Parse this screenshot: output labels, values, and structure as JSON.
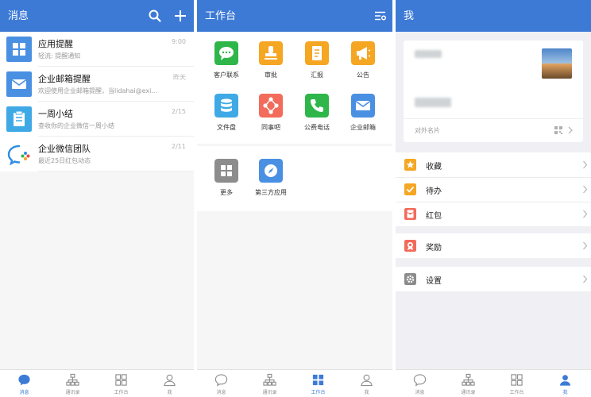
{
  "colors": {
    "primary": "#3d7ad6",
    "tab_inactive": "#8e8e8e"
  },
  "messages": {
    "header": {
      "title": "消息",
      "search_icon": "search-icon",
      "add_icon": "plus-icon"
    },
    "items": [
      {
        "title": "应用提醒",
        "subtitle": "轻流: 提醒通知",
        "time": "9:00",
        "icon": "grid-app-icon",
        "color": "#4a90e2"
      },
      {
        "title": "企业邮箱提醒",
        "subtitle": "欢迎使用企业邮箱提醒，当lidahai@exi...",
        "time": "昨天",
        "icon": "mail-icon",
        "color": "#4a90e2"
      },
      {
        "title": "一周小结",
        "subtitle": "查收你的企业微信一周小结",
        "time": "2/15",
        "icon": "clipboard-icon",
        "color": "#3fa9e6"
      },
      {
        "title": "企业微信团队",
        "subtitle": "最近25日红包动态",
        "time": "2/11",
        "icon": "wework-logo-icon",
        "color": "#3fa9e6"
      }
    ]
  },
  "workbench": {
    "header": {
      "title": "工作台",
      "settings_icon": "list-settings-icon"
    },
    "apps": [
      {
        "label": "客户联系",
        "icon": "chat-bubble-icon",
        "color": "#2fb64a"
      },
      {
        "label": "审批",
        "icon": "stamp-icon",
        "color": "#f5a623"
      },
      {
        "label": "汇报",
        "icon": "report-icon",
        "color": "#f5a623"
      },
      {
        "label": "公告",
        "icon": "megaphone-icon",
        "color": "#f5a623"
      },
      {
        "label": "文件盘",
        "icon": "database-icon",
        "color": "#3fa9e6"
      },
      {
        "label": "同事吧",
        "icon": "network-icon",
        "color": "#f26b5b"
      },
      {
        "label": "公费电话",
        "icon": "phone-icon",
        "color": "#2fb64a"
      },
      {
        "label": "企业邮箱",
        "icon": "mail-icon",
        "color": "#4a90e2"
      }
    ],
    "extra": [
      {
        "label": "更多",
        "icon": "grid-more-icon",
        "color": "#8c8c8c"
      },
      {
        "label": "第三方应用",
        "icon": "compass-icon",
        "color": "#4a90e2"
      }
    ]
  },
  "me": {
    "header": {
      "title": "我"
    },
    "card": {
      "footer_label": "对外名片",
      "qr_icon": "qr-code-icon"
    },
    "group1": [
      {
        "label": "收藏",
        "icon": "star-icon",
        "color": "#f5a623"
      },
      {
        "label": "待办",
        "icon": "checkbox-icon",
        "color": "#f5a623"
      },
      {
        "label": "红包",
        "icon": "red-packet-icon",
        "color": "#f26b5b"
      }
    ],
    "group2": [
      {
        "label": "奖励",
        "icon": "medal-icon",
        "color": "#f26b5b"
      }
    ],
    "group3": [
      {
        "label": "设置",
        "icon": "gear-icon",
        "color": "#8c8c8c"
      }
    ]
  },
  "tabbar": {
    "tabs": [
      {
        "label": "消息",
        "icon": "chat-tab-icon"
      },
      {
        "label": "通讯录",
        "icon": "contacts-tab-icon"
      },
      {
        "label": "工作台",
        "icon": "workbench-tab-icon"
      },
      {
        "label": "我",
        "icon": "me-tab-icon"
      }
    ]
  }
}
